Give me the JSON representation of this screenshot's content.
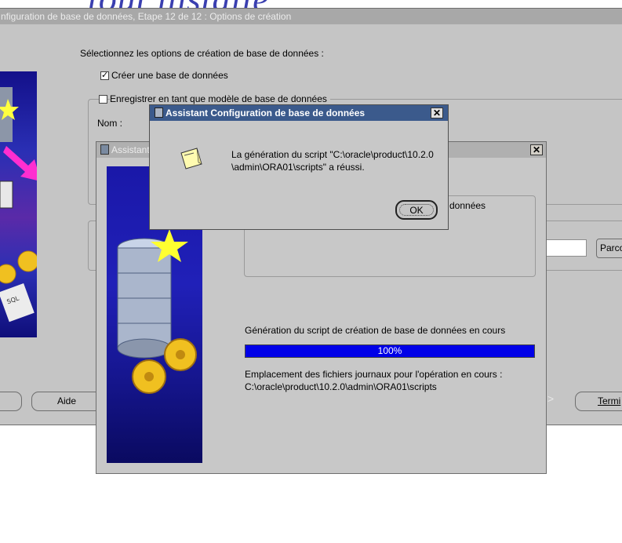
{
  "background": {
    "text": "tout installé"
  },
  "main_window": {
    "title": "nfiguration de base de données, Etape 12 de 12 : Options de création",
    "prompt": "Sélectionnez les options de création de base de données :",
    "create_db_label": "Créer une base de données",
    "create_db_checked": true,
    "save_template_label": "Enregistrer en tant que modèle de base de données",
    "save_template_checked": false,
    "name_label": "Nom :",
    "db_label_fragment": "données",
    "browse_label": "Parco",
    "help_label": "Aide",
    "finish_label": "Termi"
  },
  "progress_window": {
    "title": "Assistant",
    "status_text": "Génération du script de création de base de données en cours",
    "progress_percent": 100,
    "progress_label": "100%",
    "log_label": "Emplacement des fichiers journaux pour l'opération en cours :",
    "log_path": "C:\\oracle\\product\\10.2.0\\admin\\ORA01\\scripts"
  },
  "alert_dialog": {
    "title": "Assistant Configuration de base de données",
    "message_line1": "La génération du script \"C:\\oracle\\product\\10.2.0",
    "message_line2": "\\admin\\ORA01\\scripts\" a réussi.",
    "ok_label": "OK",
    "icon": "note-icon"
  },
  "colors": {
    "title_active": "#3b5a8c",
    "title_inactive": "#a8a8a8",
    "progress": "#0000e8",
    "window_bg": "#c5c5c5"
  }
}
